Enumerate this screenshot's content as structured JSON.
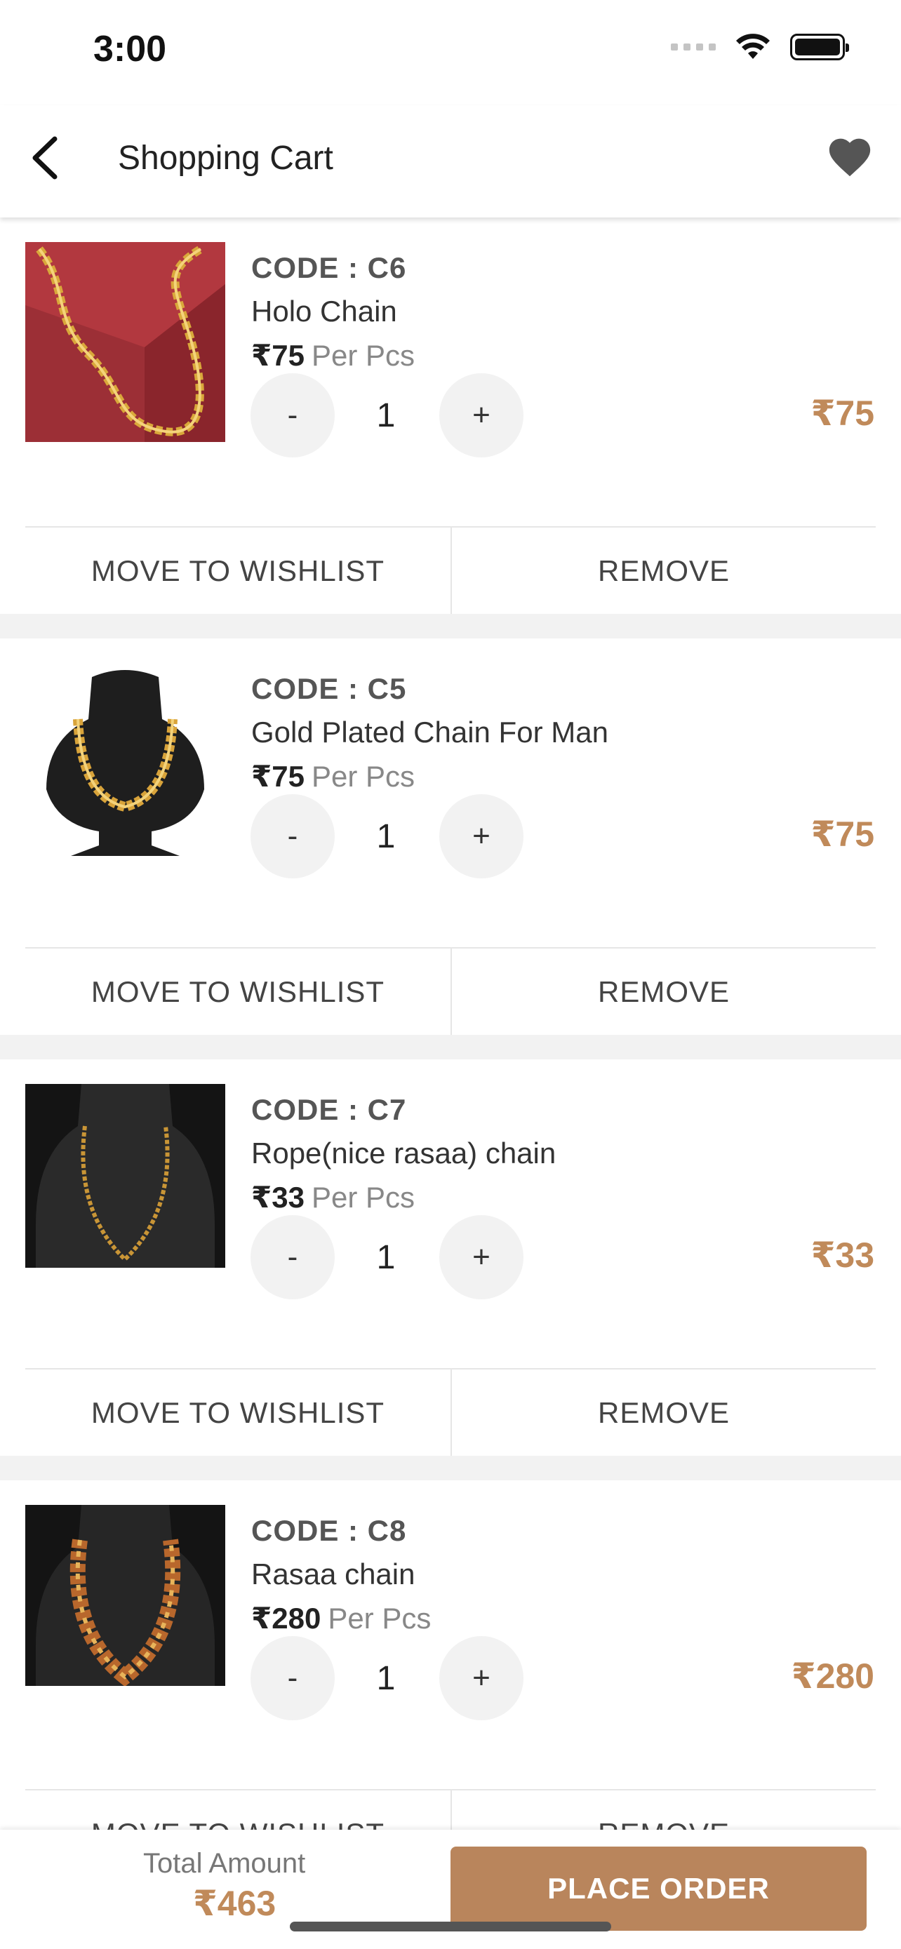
{
  "status_bar": {
    "time": "3:00"
  },
  "header": {
    "title": "Shopping Cart"
  },
  "cart": {
    "items": [
      {
        "code": "CODE : C6",
        "name": "Holo Chain",
        "price": "₹75",
        "unit": "Per Pcs",
        "quantity": "1",
        "total": "₹75",
        "minus": "-",
        "plus": "+",
        "move_label": "MOVE TO WISHLIST",
        "remove_label": "REMOVE",
        "image": "red-background-rope-chain"
      },
      {
        "code": "CODE : C5",
        "name": "Gold Plated  Chain For Man",
        "price": "₹75",
        "unit": "Per Pcs",
        "quantity": "1",
        "total": "₹75",
        "minus": "-",
        "plus": "+",
        "move_label": "MOVE TO WISHLIST",
        "remove_label": "REMOVE",
        "image": "black-bust-gold-chain"
      },
      {
        "code": "CODE : C7",
        "name": "Rope(nice rasaa) chain",
        "price": "₹33",
        "unit": "Per Pcs",
        "quantity": "1",
        "total": "₹33",
        "minus": "-",
        "plus": "+",
        "move_label": "MOVE TO WISHLIST",
        "remove_label": "REMOVE",
        "image": "dark-bust-thin-chain"
      },
      {
        "code": "CODE : C8",
        "name": "Rasaa chain",
        "price": "₹280",
        "unit": "Per Pcs",
        "quantity": "1",
        "total": "₹280",
        "minus": "-",
        "plus": "+",
        "move_label": "MOVE TO WISHLIST",
        "remove_label": "REMOVE",
        "image": "dark-bust-thick-chain"
      }
    ]
  },
  "footer": {
    "total_label": "Total Amount",
    "total_value": "₹463",
    "place_order_label": "PLACE ORDER"
  },
  "colors": {
    "accent": "#b9855c",
    "price_accent": "#c08a5a",
    "divider": "#e6e6e6",
    "background_gap": "#f2f2f2"
  }
}
